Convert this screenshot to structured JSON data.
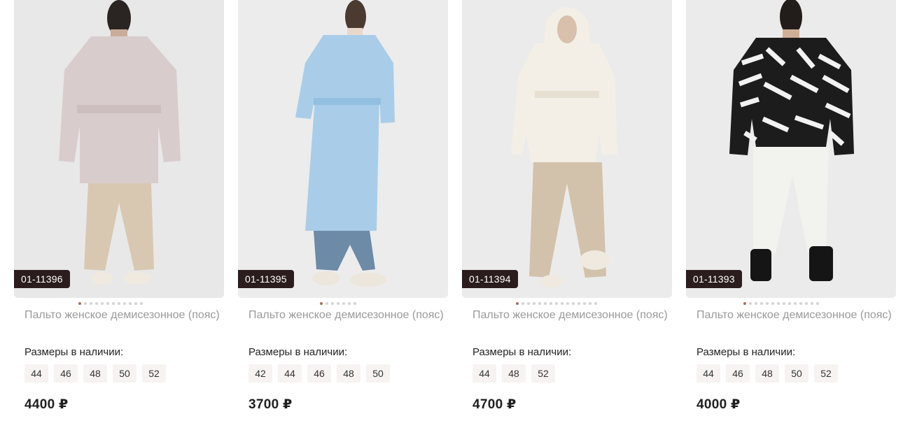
{
  "currency": "₽",
  "sizes_label": "Размеры в наличии:",
  "products": [
    {
      "sku": "01-11396",
      "title": "Пальто женское демисезонное (пояс)",
      "sizes": [
        "44",
        "46",
        "48",
        "50",
        "52"
      ],
      "price": "4400 ₽",
      "image_icon": "product-photo",
      "coat_color": "#d9cccd",
      "trouser_color": "#d8c8b2",
      "dots_total": 12,
      "dot_active": 0
    },
    {
      "sku": "01-11395",
      "title": "Пальто женское демисезонное (пояс)",
      "sizes": [
        "42",
        "44",
        "46",
        "48",
        "50"
      ],
      "price": "3700 ₽",
      "image_icon": "product-photo",
      "coat_color": "#a9cde9",
      "trouser_color": "#6d8aa6",
      "dots_total": 7,
      "dot_active": 0
    },
    {
      "sku": "01-11394",
      "title": "Пальто женское демисезонное (пояс)",
      "sizes": [
        "44",
        "48",
        "52"
      ],
      "price": "4700 ₽",
      "image_icon": "product-photo",
      "coat_color": "#f3efe6",
      "trouser_color": "#d3c2ab",
      "dots_total": 15,
      "dot_active": 0
    },
    {
      "sku": "01-11393",
      "title": "Пальто женское демисезонное (пояс)",
      "sizes": [
        "44",
        "46",
        "48",
        "50",
        "52"
      ],
      "price": "4000 ₽",
      "image_icon": "product-photo",
      "coat_color": "#1c1c1c",
      "trouser_color": "#f2f2ee",
      "dots_total": 14,
      "dot_active": 0
    }
  ]
}
